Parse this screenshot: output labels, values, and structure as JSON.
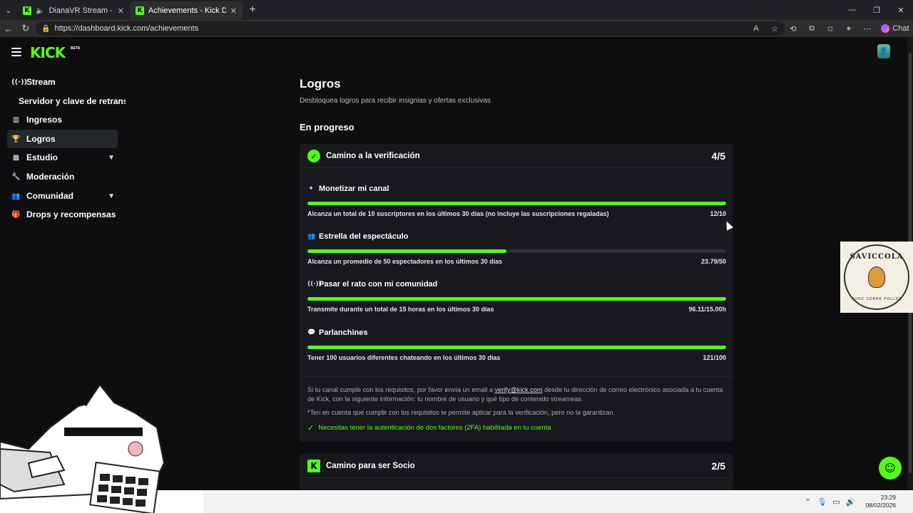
{
  "browser": {
    "tabs": [
      {
        "title": "DianaVR Stream - Watch Live"
      },
      {
        "title": "Achievements - Kick Dashboard"
      }
    ],
    "url": "https://dashboard.kick.com/achievements",
    "chat_label": "Chat"
  },
  "header": {
    "logo": "KICK",
    "beta": "BETA"
  },
  "sidebar": {
    "items": [
      {
        "label": "Stream",
        "icon": "broadcast-icon"
      },
      {
        "label": "Servidor y clave de retransmisión",
        "icon": ""
      },
      {
        "label": "Ingresos",
        "icon": "chart-icon"
      },
      {
        "label": "Logros",
        "icon": "trophy-icon"
      },
      {
        "label": "Estudio",
        "icon": "grid-icon"
      },
      {
        "label": "Moderación",
        "icon": "wrench-icon"
      },
      {
        "label": "Comunidad",
        "icon": "people-icon"
      },
      {
        "label": "Drops y recompensas",
        "icon": "gift-icon"
      }
    ]
  },
  "main": {
    "title": "Logros",
    "subtitle": "Desbloquea logros para recibir insignias y ofertas exclusivas",
    "section": "En progreso",
    "card1": {
      "title": "Camino a la verificación",
      "count": "4/5",
      "achievements": [
        {
          "title": "Monetizar mi canal",
          "desc": "Alcanza un total de 10 suscriptores en los últimos 30 días (no incluye las suscripciones regaladas)",
          "value": "12/10",
          "progress": 1.0
        },
        {
          "title": "Estrella del espectáculo",
          "desc": "Alcanza un promedio de 50 espectadores en los últimos 30 días",
          "value": "23.79/50",
          "progress": 0.4758
        },
        {
          "title": "Pasar el rato con mi comunidad",
          "desc": "Transmite durante un total de 15 horas en los últimos 30 días",
          "value": "96.11/15.00h",
          "progress": 1.0
        },
        {
          "title": "Parlanchines",
          "desc": "Tener 100 usuarios diferentes chateando en los últimos 30 días",
          "value": "121/100",
          "progress": 1.0
        }
      ],
      "note_pre": "Si tu canal cumple con los requisitos, por favor envía un email a ",
      "note_email": "verify@kick.com",
      "note_post": " desde tu dirección de correo electrónico asociada a tu cuenta de Kick, con la siguiente información: tu nombre de usuario y qué tipo de contenido streameas.",
      "note2": "*Ten en cuenta que cumplir con los requisitos te permite aplicar para la verificación, pero no la garantizan.",
      "requirement": "Necesitas tener la autenticación de dos factores (2FA) habilitada en tu cuenta"
    },
    "card2": {
      "title": "Camino para ser Socio",
      "count": "2/5"
    }
  },
  "overlay": {
    "logo_top": "SAVICCOLA",
    "logo_bottom": "TODO SOBRE POLLOS"
  },
  "taskbar": {
    "time": "23:29",
    "date": "08/02/2026"
  },
  "colors": {
    "accent": "#53fc18",
    "background": "#0e0e10",
    "card": "#18191c"
  }
}
